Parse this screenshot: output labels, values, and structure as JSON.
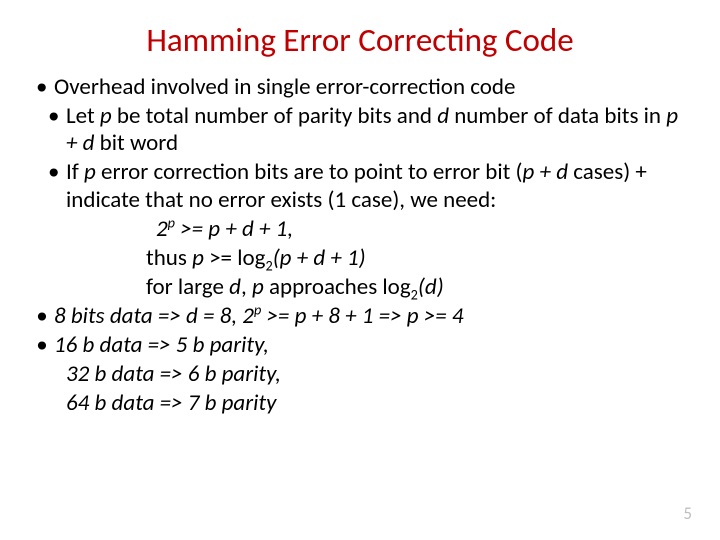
{
  "title": "Hamming Error Correcting Code",
  "bullets": {
    "b1": "Overhead involved in single error-correction code",
    "b2_pre": "Let ",
    "b2_p": "p",
    "b2_mid1": " be total number of parity bits and ",
    "b2_d": "d",
    "b2_mid2": " number of data bits in  ",
    "b2_expr": "p + d",
    "b2_post": " bit word",
    "b3_pre": "If ",
    "b3_p": "p",
    "b3_mid1": " error correction bits are to point to error bit (",
    "b3_expr": "p + d",
    "b3_mid2": " cases) + indicate that no error exists (1 case), we need:",
    "f1_pre": "2",
    "f1_sup": "p",
    "f1_post": " >= p + d + 1,",
    "f2_pre": "thus ",
    "f2_p": "p",
    "f2_mid": " >= log",
    "f2_sub": "2",
    "f2_post": "(p + d + 1)",
    "f3_pre": "for large ",
    "f3_d": "d",
    "f3_mid1": ", ",
    "f3_p": "p",
    "f3_mid2": " approaches log",
    "f3_sub": "2",
    "f3_post": "(d)",
    "b4_pre": "8 bits data =>  d = 8, 2",
    "b4_sup": "p",
    "b4_post": " >= p + 8 + 1 => p >= 4",
    "b5": "16 b data => 5 b parity,",
    "b5_l2": "32 b data => 6 b parity,",
    "b5_l3": "64 b data => 7 b parity"
  },
  "page_number": "5"
}
